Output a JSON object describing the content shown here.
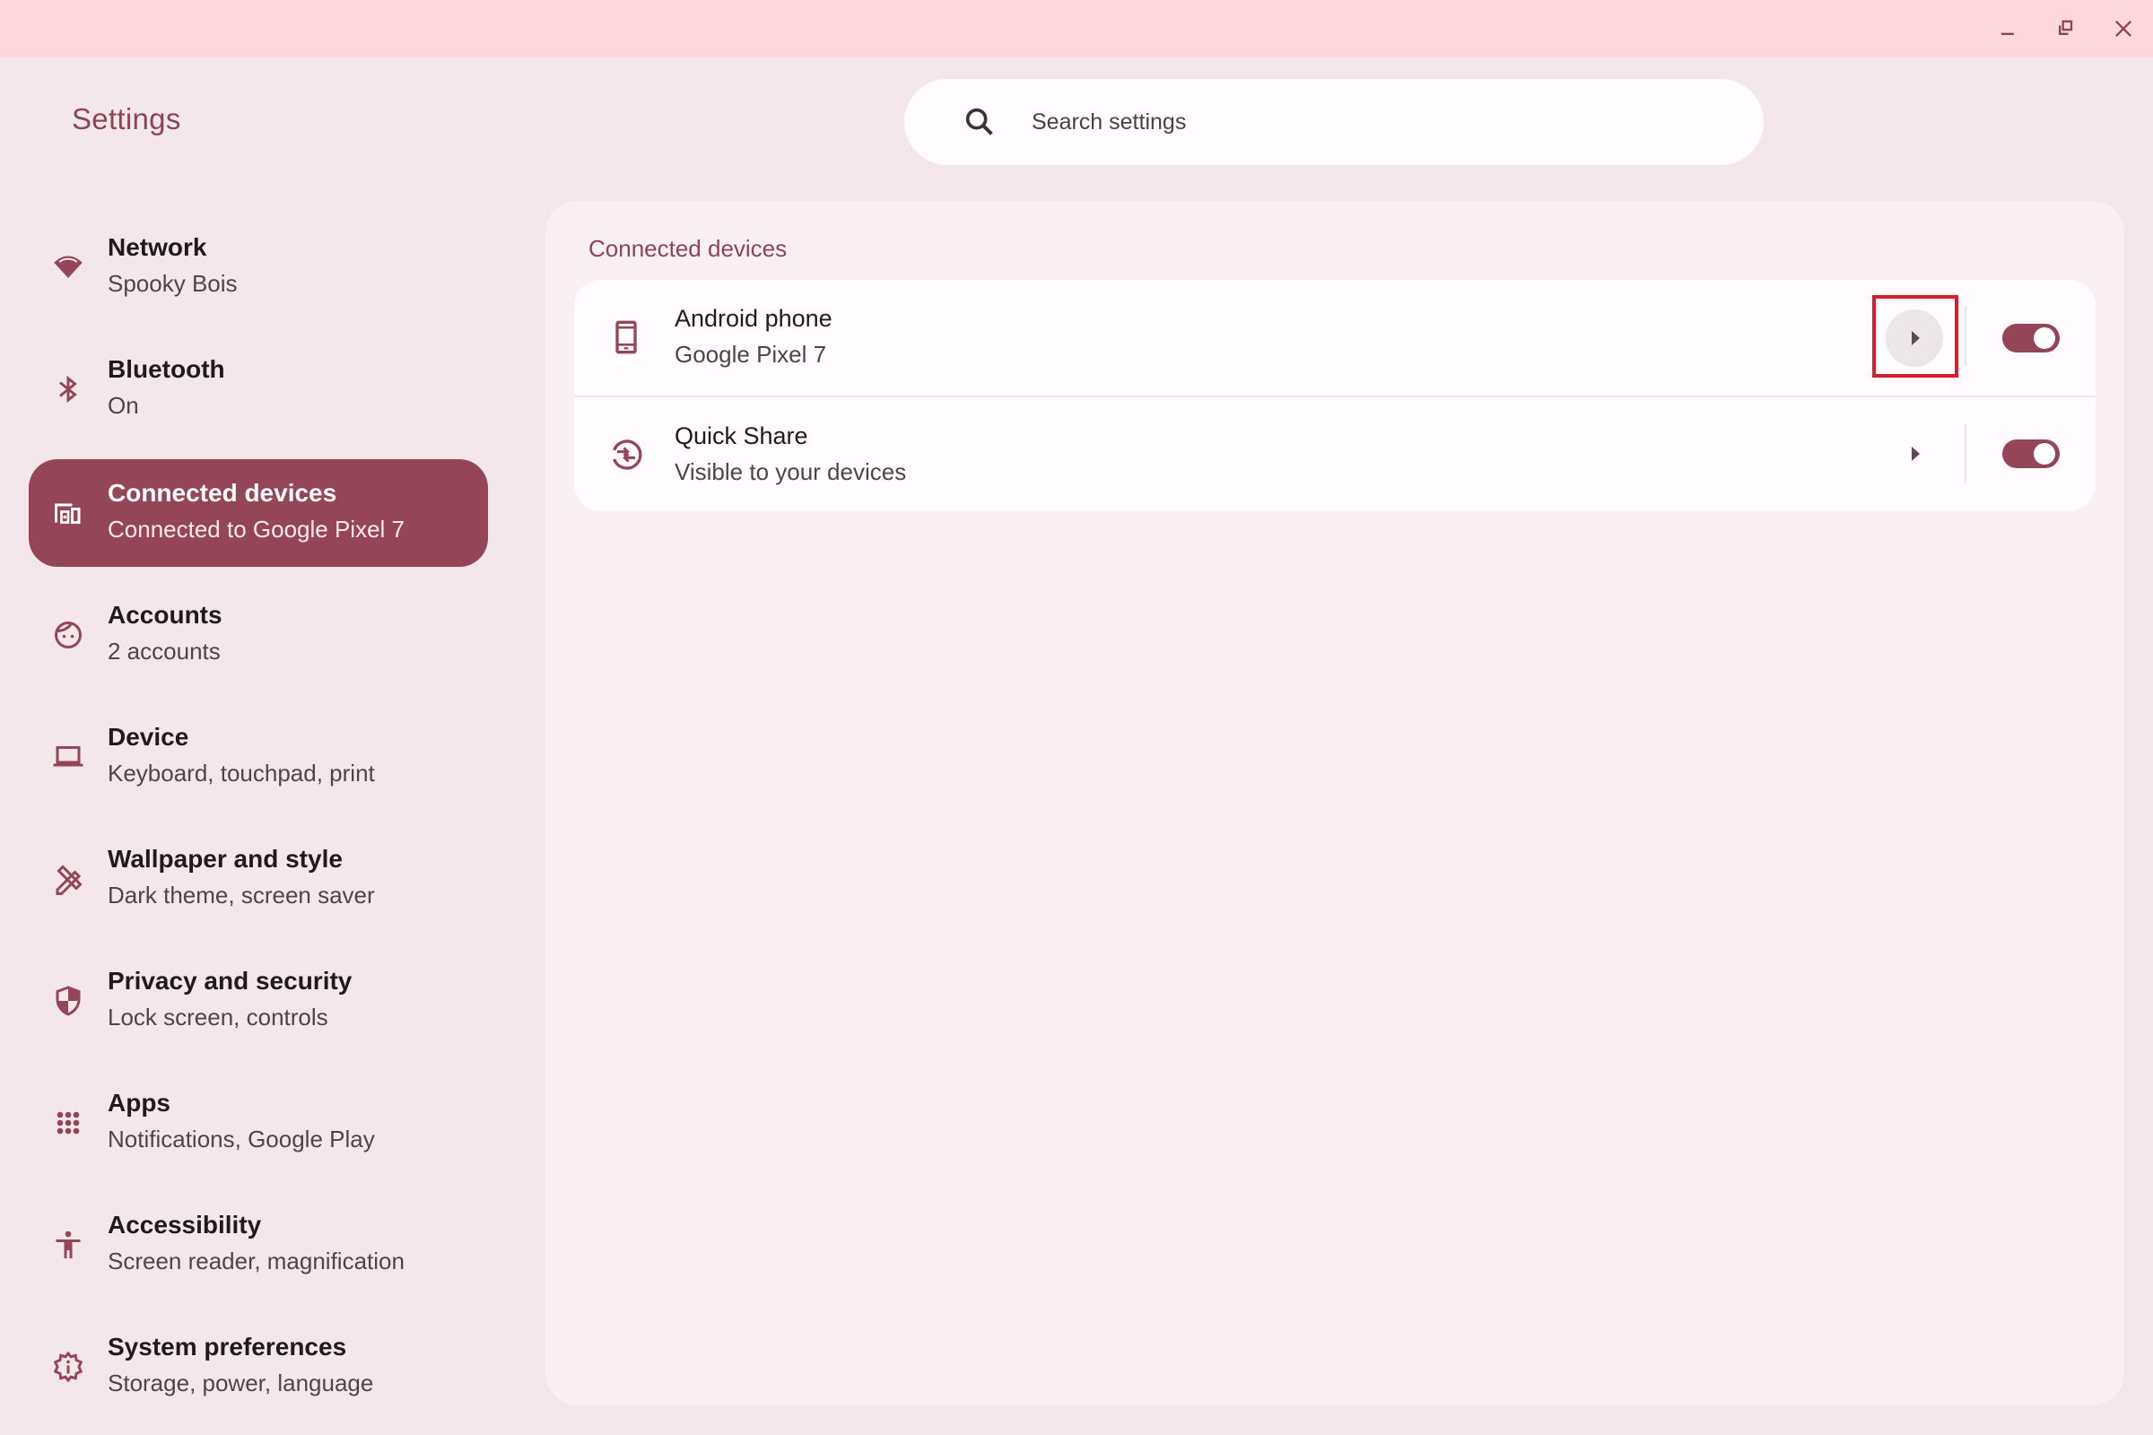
{
  "window": {
    "controls": {
      "minimize": "minimize-icon",
      "restore": "restore-icon",
      "close": "close-icon"
    }
  },
  "app": {
    "title": "Settings"
  },
  "search": {
    "placeholder": "Search settings",
    "value": ""
  },
  "sidebar": {
    "items": [
      {
        "label": "Network",
        "sub": "Spooky Bois",
        "icon": "wifi-icon",
        "active": false
      },
      {
        "label": "Bluetooth",
        "sub": "On",
        "icon": "bluetooth-icon",
        "active": false
      },
      {
        "label": "Connected devices",
        "sub": "Connected to Google Pixel 7",
        "icon": "connected-devices-icon",
        "active": true
      },
      {
        "label": "Accounts",
        "sub": "2 accounts",
        "icon": "face-icon",
        "active": false
      },
      {
        "label": "Device",
        "sub": "Keyboard, touchpad, print",
        "icon": "laptop-icon",
        "active": false
      },
      {
        "label": "Wallpaper and style",
        "sub": "Dark theme, screen saver",
        "icon": "design-icon",
        "active": false
      },
      {
        "label": "Privacy and security",
        "sub": "Lock screen, controls",
        "icon": "shield-icon",
        "active": false
      },
      {
        "label": "Apps",
        "sub": "Notifications, Google Play",
        "icon": "apps-grid-icon",
        "active": false
      },
      {
        "label": "Accessibility",
        "sub": "Screen reader, magnification",
        "icon": "accessibility-icon",
        "active": false
      },
      {
        "label": "System preferences",
        "sub": "Storage, power, language",
        "icon": "settings-info-icon",
        "active": false
      }
    ]
  },
  "main": {
    "section_title": "Connected devices",
    "rows": [
      {
        "title": "Android phone",
        "sub": "Google Pixel 7",
        "icon": "phone-icon",
        "toggle_on": true,
        "highlighted": true
      },
      {
        "title": "Quick Share",
        "sub": "Visible to your devices",
        "icon": "quick-share-icon",
        "toggle_on": true,
        "highlighted": false
      }
    ]
  },
  "colors": {
    "accent": "#944658",
    "titlebar": "#FFD8DD",
    "background": "#F4E7EB",
    "card": "#FAF0F4",
    "highlight": "#D4202C"
  }
}
